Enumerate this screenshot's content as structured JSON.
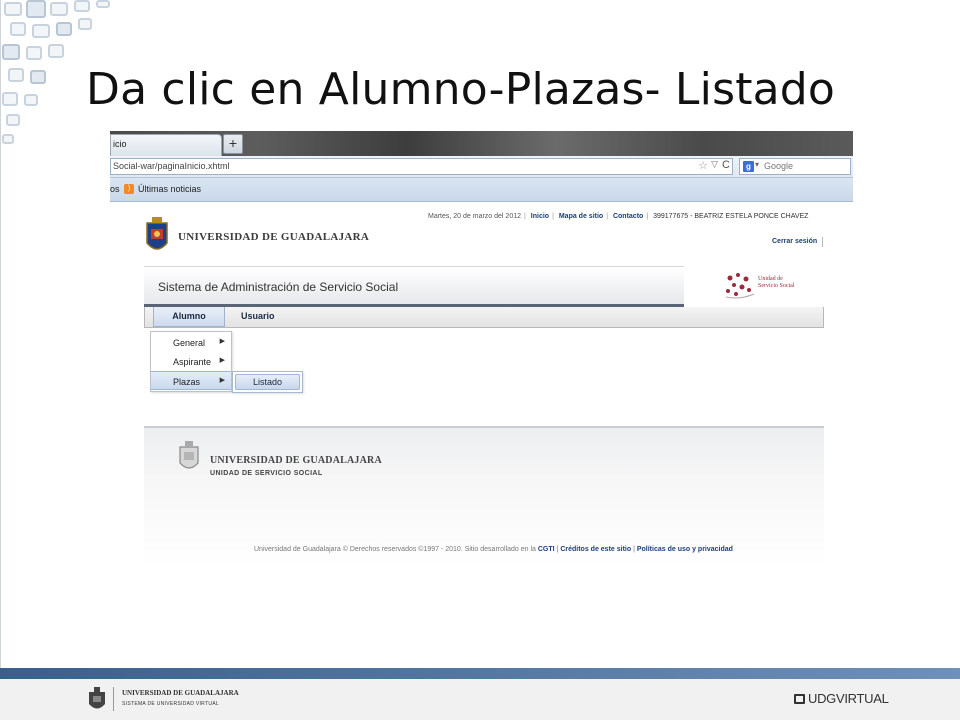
{
  "slide": {
    "title": "Da clic en Alumno-Plazas- Listado"
  },
  "browser": {
    "tab_title": "icio",
    "new_tab_label": "+",
    "url": "Social-war/paginaInicio.xhtml",
    "search_placeholder": "Google",
    "bookmark_left": "os",
    "bookmark_news": "Últimas noticias"
  },
  "page": {
    "date": "Martes, 20 de marzo del 2012",
    "links": [
      "Inicio",
      "Mapa de sitio",
      "Contacto"
    ],
    "user": "399177675 - BEATRIZ ESTELA PONCE CHAVEZ",
    "logout": "Cerrar sesión",
    "university": "UNIVERSIDAD DE GUADALAJARA",
    "system_title": "Sistema de Administración de Servicio Social",
    "uss_logo_line1": "Unidad de",
    "uss_logo_line2": "Servicio Social",
    "menu": {
      "alumno": "Alumno",
      "usuario": "Usuario",
      "dropdown": [
        {
          "label": "General"
        },
        {
          "label": "Aspirante"
        },
        {
          "label": "Plazas"
        }
      ],
      "submenu": "Listado"
    },
    "footer": {
      "university": "UNIVERSIDAD DE GUADALAJARA",
      "unit": "UNIDAD DE SERVICIO SOCIAL",
      "copyright": "Universidad de Guadalajara © Derechos reservados ©1997 - 2010. Sitio desarrollado en la",
      "cgti": "CGTI",
      "credits": "Créditos de este sitio",
      "policies": "Políticas de uso y privacidad"
    }
  },
  "slide_footer": {
    "name": "UNIVERSIDAD DE GUADALAJARA",
    "sub": "SISTEMA DE UNIVERSIDAD VIRTUAL",
    "brand": "UDGVIRTUAL"
  },
  "colors": {
    "link_blue": "#1d3f7a",
    "band_blue": "#3a5f8c",
    "uss_red": "#9b2b3a"
  }
}
